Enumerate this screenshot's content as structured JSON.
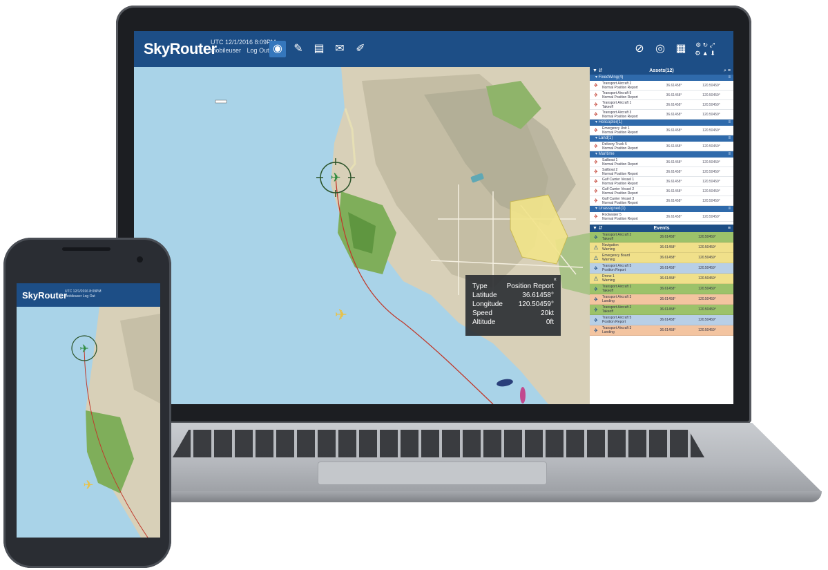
{
  "app": {
    "brand": "SkyRouter",
    "clock": "UTC 12/1/2016 8:09PM",
    "user": "mobileuser",
    "logout": "Log Out",
    "header_icons": [
      "globe-icon",
      "wrench-icon",
      "document-icon",
      "mail-icon",
      "edit-icon"
    ],
    "right_icons": [
      "layers-icon",
      "compass-icon",
      "grid-icon",
      "settings-icon"
    ]
  },
  "assets": {
    "title": "Assets(12)",
    "groups": [
      {
        "name": "FixedWing(4)",
        "items": [
          {
            "name": "Transport Aircraft 2",
            "status": "Normal Position Report",
            "coord": "36.61458°",
            "info": "120.50459°"
          },
          {
            "name": "Transport Aircraft 5",
            "status": "Normal Position Report",
            "coord": "36.61458°",
            "info": "120.50459°"
          },
          {
            "name": "Transport Aircraft 1",
            "status": "Takeoff",
            "coord": "36.61458°",
            "info": "120.50459°"
          },
          {
            "name": "Transport Aircraft 3",
            "status": "Normal Position Report",
            "coord": "36.61458°",
            "info": "120.50459°"
          }
        ]
      },
      {
        "name": "Helicopter(1)",
        "items": [
          {
            "name": "Emergency Unit 1",
            "status": "Normal Position Report",
            "coord": "36.61458°",
            "info": "120.50459°"
          }
        ]
      },
      {
        "name": "Land(1)",
        "items": [
          {
            "name": "Delivery Truck 5",
            "status": "Normal Position Report",
            "coord": "36.61458°",
            "info": "120.50459°"
          }
        ]
      },
      {
        "name": "Maritime",
        "items": [
          {
            "name": "Sailboat 1",
            "status": "Normal Position Report",
            "coord": "36.61458°",
            "info": "120.50459°"
          },
          {
            "name": "Sailboat 2",
            "status": "Normal Position Report",
            "coord": "36.61458°",
            "info": "120.50459°"
          },
          {
            "name": "Gulf Carrier Vessel 1",
            "status": "Normal Position Report",
            "coord": "36.61458°",
            "info": "120.50459°"
          },
          {
            "name": "Gulf Carrier Vessel 2",
            "status": "Normal Position Report",
            "coord": "36.61458°",
            "info": "120.50459°"
          },
          {
            "name": "Gulf Carrier Vessel 3",
            "status": "Normal Position Report",
            "coord": "36.61458°",
            "info": "120.50459°"
          }
        ]
      },
      {
        "name": "Unassigned(1)",
        "items": [
          {
            "name": "Rockwater 5",
            "status": "Normal Position Report",
            "coord": "36.61458°",
            "info": "120.50459°"
          }
        ]
      }
    ]
  },
  "events": {
    "title": "Events",
    "items": [
      {
        "name": "Transport Aircraft 2",
        "type": "Takeoff",
        "val": "36.61458°",
        "pos": "120.50459°",
        "color": "#9cc26a",
        "icon": "plane-icon"
      },
      {
        "name": "Navigation",
        "type": "Warning",
        "val": "36.61458°",
        "pos": "120.50459°",
        "color": "#f0e08a",
        "icon": "warning-icon"
      },
      {
        "name": "Emergency Board",
        "type": "Warning",
        "val": "36.61458°",
        "pos": "120.50459°",
        "color": "#f0e08a",
        "icon": "warning-icon"
      },
      {
        "name": "Transport Aircraft 5",
        "type": "Position Report",
        "val": "36.61458°",
        "pos": "120.50459°",
        "color": "#b8cfe6",
        "icon": "plane-icon"
      },
      {
        "name": "Drone 1",
        "type": "Warning",
        "val": "36.61458°",
        "pos": "120.50459°",
        "color": "#f0e08a",
        "icon": "warning-icon"
      },
      {
        "name": "Transport Aircraft 1",
        "type": "Takeoff",
        "val": "36.61458°",
        "pos": "120.50459°",
        "color": "#9cc26a",
        "icon": "plane-icon"
      },
      {
        "name": "Transport Aircraft 3",
        "type": "Landing",
        "val": "36.61458°",
        "pos": "120.50459°",
        "color": "#f3c4a0",
        "icon": "plane-icon"
      },
      {
        "name": "Transport Aircraft 2",
        "type": "Takeoff",
        "val": "36.61458°",
        "pos": "120.50459°",
        "color": "#9cc26a",
        "icon": "plane-icon"
      },
      {
        "name": "Transport Aircraft 5",
        "type": "Position Report",
        "val": "36.61458°",
        "pos": "120.50459°",
        "color": "#b8cfe6",
        "icon": "plane-icon"
      },
      {
        "name": "Transport Aircraft 3",
        "type": "Landing",
        "val": "36.61458°",
        "pos": "120.50459°",
        "color": "#f3c4a0",
        "icon": "plane-icon"
      }
    ]
  },
  "tooltip": {
    "rows": [
      {
        "k": "Type",
        "v": "Position Report"
      },
      {
        "k": "Latitude",
        "v": "36.61458°"
      },
      {
        "k": "Longitude",
        "v": "120.50459°"
      },
      {
        "k": "Speed",
        "v": "20kt"
      },
      {
        "k": "Altitude",
        "v": "0ft"
      }
    ]
  },
  "phone": {
    "brand": "SkyRouter",
    "clock": "UTC 12/1/2016 8:09PM",
    "user": "mobileuser  Log Out"
  }
}
